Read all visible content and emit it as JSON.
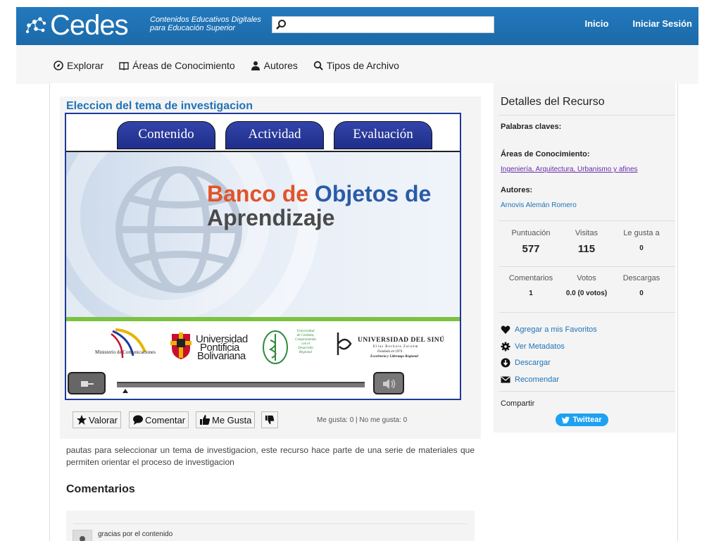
{
  "header": {
    "logo_text": "Cedes",
    "tagline_line1": "Contenidos Educativos Digitales",
    "tagline_line2": "para Educación Superior",
    "search_placeholder": "",
    "nav": [
      "Inicio",
      "Iniciar Sesión"
    ]
  },
  "subnav": {
    "items": [
      {
        "label": "Explorar",
        "icon": "compass-icon"
      },
      {
        "label": "Áreas de Conocimiento",
        "icon": "book-icon"
      },
      {
        "label": "Autores",
        "icon": "user-icon"
      },
      {
        "label": "Tipos de Archivo",
        "icon": "search-icon"
      }
    ]
  },
  "resource": {
    "title": "Eleccion del tema de investigacion",
    "viewer": {
      "tabs": [
        "Contenido",
        "Actividad",
        "Evaluación"
      ],
      "banner_word1": "Banco de",
      "banner_word2": "Objetos de",
      "banner_word3": "Aprendizaje",
      "logos": {
        "min_com": "Ministerio de Comunicaciones",
        "upb_line1": "Universidad",
        "upb_line2": "Pontificia",
        "upb_line3": "Bolivariana",
        "cordoba_line1": "Universidad",
        "cordoba_line2": "de Córdoba,",
        "cordoba_line3": "Comprometida",
        "cordoba_line4": "con el",
        "cordoba_line5": "Desarrollo",
        "cordoba_line6": "Regional",
        "sinu_line1": "Universidad del Sinú",
        "sinu_line2": "Elías Bechara Zainúm",
        "sinu_line3": "Fundada en 1974",
        "sinu_line4": "Excelencia y Liderazgo Regional"
      }
    },
    "actions": {
      "valorar": "Valorar",
      "comentar": "Comentar",
      "me_gusta": "Me Gusta",
      "likes_text": "Me gusta: 0 | No me gusta: 0"
    },
    "description": "pautas para seleccionar un tema de investigacion, este recurso hace parte de una serie de materiales que permiten orientar el proceso de investigacion",
    "comments_heading": "Comentarios",
    "comments": [
      {
        "text": "gracias por el contenido"
      }
    ]
  },
  "details": {
    "title": "Detalles del Recurso",
    "keywords_label": "Palabras claves:",
    "areas_label": "Áreas de Conocimiento:",
    "areas_value": "Ingeniería, Arquitectura, Urbanismo y afines",
    "authors_label": "Autores:",
    "authors_value": "Arnovis Alemán Romero",
    "stats": [
      {
        "label": "Puntuación",
        "value": "577"
      },
      {
        "label": "Visitas",
        "value": "115"
      },
      {
        "label": "Le gusta a",
        "value": "0"
      },
      {
        "label": "Comentarios",
        "value": "1"
      },
      {
        "label": "Votos",
        "value": "0.0 (0 votos)"
      },
      {
        "label": "Descargas",
        "value": "0"
      }
    ],
    "actions": [
      {
        "label": "Agregar a mis Favoritos",
        "icon": "heart-icon"
      },
      {
        "label": "Ver Metadatos",
        "icon": "gear-icon"
      },
      {
        "label": "Descargar",
        "icon": "download-icon"
      },
      {
        "label": "Recomendar",
        "icon": "envelope-icon"
      }
    ],
    "share_label": "Compartir",
    "tweet_label": "Twittear"
  },
  "colors": {
    "brand_blue": "#1f73b7",
    "viewer_border": "#1f3a9a",
    "tab_blue": "#2a3a9e",
    "twitter": "#1da1f2"
  }
}
